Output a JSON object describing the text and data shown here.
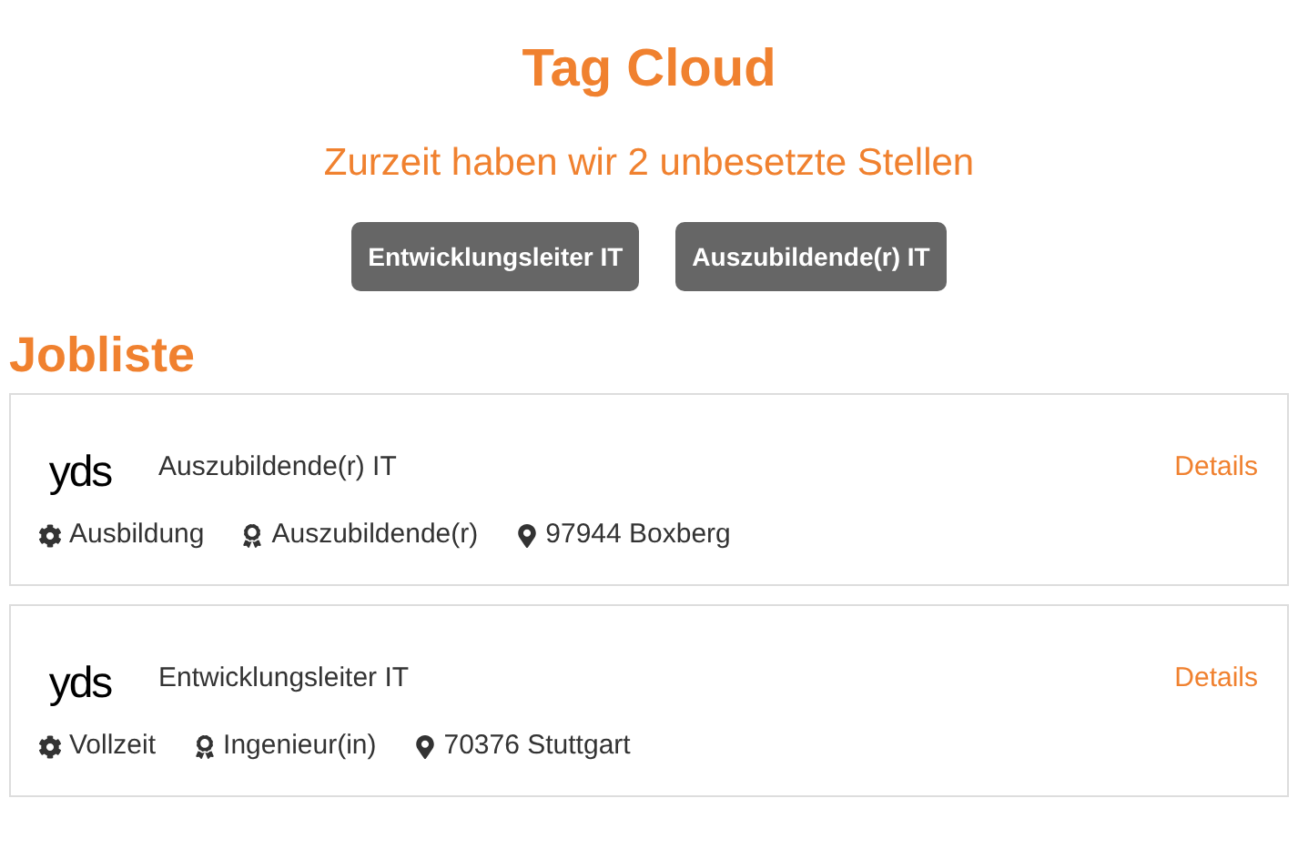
{
  "tag_cloud": {
    "title": "Tag Cloud",
    "subtitle": "Zurzeit haben wir 2 unbesetzte Stellen",
    "tags": [
      "Entwicklungsleiter IT",
      "Auszubildende(r) IT"
    ]
  },
  "job_list": {
    "title": "Jobliste",
    "jobs": [
      {
        "logo": "yds",
        "title": "Auszubildende(r) IT",
        "link": "Details",
        "meta": [
          {
            "kind": "type",
            "text": "Ausbildung"
          },
          {
            "kind": "level",
            "text": "Auszubildende(r)"
          },
          {
            "kind": "location",
            "text": "97944 Boxberg"
          }
        ]
      },
      {
        "logo": "yds",
        "title": "Entwicklungsleiter IT",
        "link": "Details",
        "meta": [
          {
            "kind": "type",
            "text": "Vollzeit"
          },
          {
            "kind": "level",
            "text": "Ingenieur(in)"
          },
          {
            "kind": "location",
            "text": "70376 Stuttgart"
          }
        ]
      }
    ]
  }
}
